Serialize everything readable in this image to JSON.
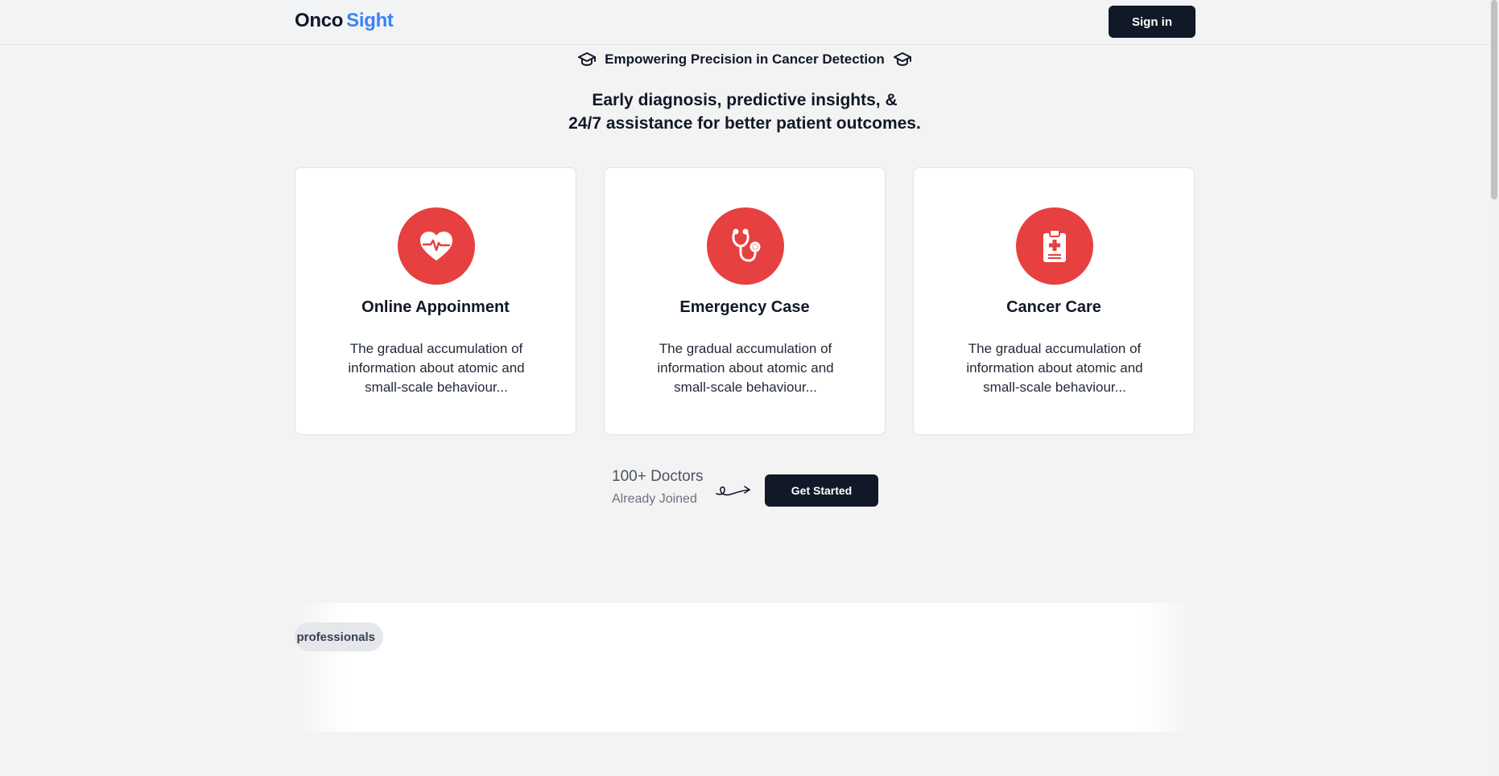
{
  "header": {
    "logo_part1": "Onco",
    "logo_part2": "Sight",
    "signin_label": "Sign in"
  },
  "hero": {
    "tagline": "Empowering Precision in Cancer Detection",
    "tagline_icon": "graduation-cap-icon",
    "headline_line1": "Early diagnosis, predictive insights, &",
    "headline_line2": "24/7 assistance for better patient outcomes."
  },
  "cards": [
    {
      "icon": "heart-pulse-icon",
      "title": "Online Appoinment",
      "description": "The gradual accumulation of information about atomic and small-scale behaviour..."
    },
    {
      "icon": "stethoscope-icon",
      "title": "Emergency Case",
      "description": "The gradual accumulation of information about atomic and small-scale behaviour..."
    },
    {
      "icon": "clipboard-medical-icon",
      "title": "Cancer Care",
      "description": "The gradual accumulation of information about atomic and small-scale behaviour..."
    }
  ],
  "cta": {
    "doctors_count": "100+ Doctors",
    "doctors_sub": "Already Joined",
    "button_label": "Get Started"
  },
  "marquee": {
    "pill_label": "professionals"
  },
  "colors": {
    "accent": "#3b82f6",
    "icon_bg": "#e64040",
    "button_bg": "#111827"
  }
}
